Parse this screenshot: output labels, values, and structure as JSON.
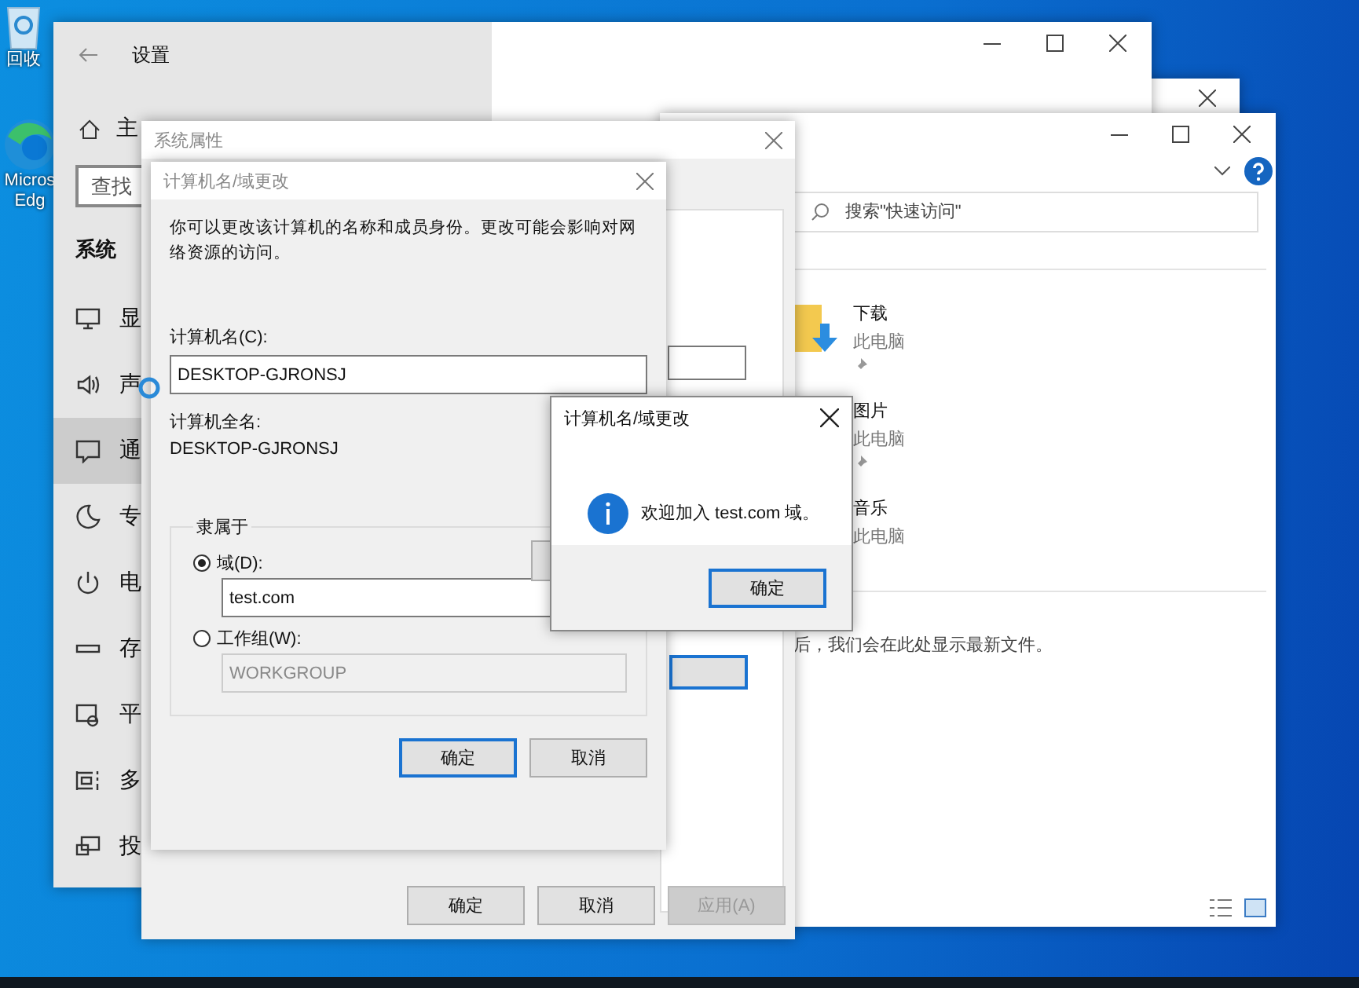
{
  "desktop": {
    "icons": [
      {
        "kind": "recycle",
        "lines": [
          "回收"
        ]
      },
      {
        "kind": "edge",
        "lines": [
          "Micros",
          "Edg"
        ]
      }
    ]
  },
  "settings_window": {
    "title": "设置",
    "home": "主",
    "search": {
      "placeholder": "查找"
    },
    "section": "系统",
    "nav": [
      {
        "kind": "display",
        "label": "显",
        "selected": false
      },
      {
        "kind": "sound",
        "label": "声",
        "selected": false
      },
      {
        "kind": "notify",
        "label": "通",
        "selected": true
      },
      {
        "kind": "focus",
        "label": "专",
        "selected": false
      },
      {
        "kind": "power",
        "label": "电",
        "selected": false
      },
      {
        "kind": "storage",
        "label": "存",
        "selected": false
      },
      {
        "kind": "tablet",
        "label": "平",
        "selected": false
      },
      {
        "kind": "multi",
        "label": "多",
        "selected": false
      },
      {
        "kind": "project",
        "label": "投",
        "selected": false
      }
    ]
  },
  "explorer": {
    "search": {
      "placeholder": "搜索\"快速访问\""
    },
    "items": [
      {
        "kind": "download",
        "name": "下载",
        "location": "此电脑",
        "pinned": true
      },
      {
        "kind": "other",
        "name": "图片",
        "location": "此电脑",
        "pinned": true
      },
      {
        "kind": "other",
        "name": "音乐",
        "location": "此电脑",
        "pinned": false
      }
    ],
    "recent_note": "后，我们会在此处显示最新文件。"
  },
  "system_properties": {
    "title": "系统属性",
    "buttons": [
      {
        "label": "确定",
        "disabled": false
      },
      {
        "label": "取消",
        "disabled": false
      },
      {
        "label": "应用(A)",
        "disabled": true
      }
    ]
  },
  "name_dialog": {
    "title": "计算机名/域更改",
    "description": "你可以更改该计算机的名称和成员身份。更改可能会影响对网络资源的访问。",
    "computer_name_label": "计算机名(C):",
    "computer_name": "DESKTOP-GJRONSJ",
    "full_name_label": "计算机全名:",
    "full_name": "DESKTOP-GJRONSJ",
    "member_of": {
      "label": "隶属于",
      "options": [
        {
          "label": "域(D):",
          "selected": true,
          "value": "test.com",
          "disabled": false
        },
        {
          "label": "工作组(W):",
          "selected": false,
          "value": "WORKGROUP",
          "disabled": true
        }
      ]
    },
    "buttons": [
      {
        "label": "确定",
        "default": true
      },
      {
        "label": "取消",
        "default": false
      }
    ]
  },
  "message_box": {
    "title": "计算机名/域更改",
    "message": "欢迎加入 test.com 域。",
    "button": "确定"
  }
}
